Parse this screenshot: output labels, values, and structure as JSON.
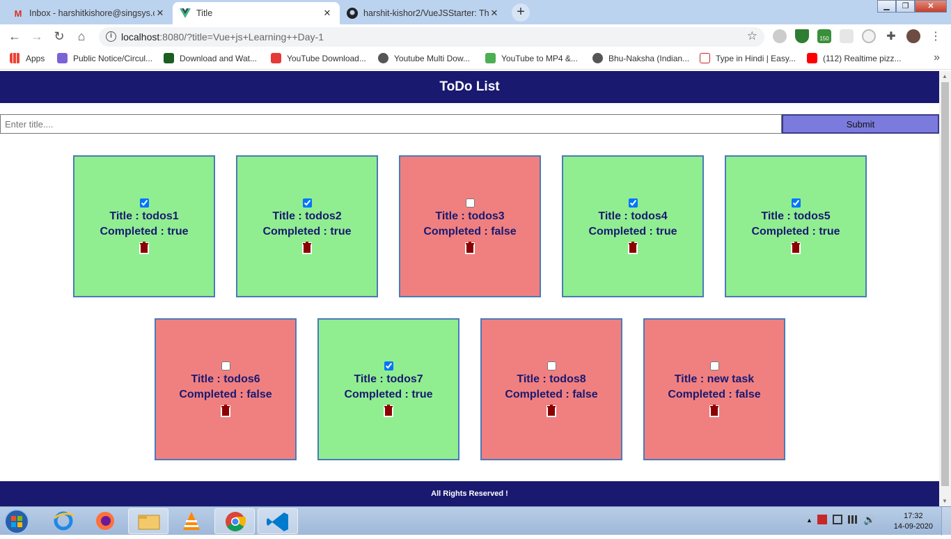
{
  "browser": {
    "tabs": [
      {
        "title": "Inbox - harshitkishore@singsys.c",
        "icon": "gmail-icon"
      },
      {
        "title": "Title",
        "icon": "vue-icon"
      },
      {
        "title": "harshit-kishor2/VueJSStarter: Thi",
        "icon": "github-icon"
      }
    ],
    "close_glyph": "✕",
    "new_tab_glyph": "+",
    "url_host": "localhost",
    "url_rest": ":8080/?title=Vue+js+Learning++Day-1",
    "extension_badge": "150",
    "bookmarks": [
      {
        "label": "Apps",
        "icon": "apps-grid-icon"
      },
      {
        "label": "Public Notice/Circul...",
        "icon": "notice-icon"
      },
      {
        "label": "Download and Wat...",
        "icon": "tr-icon"
      },
      {
        "label": "YouTube Download...",
        "icon": "download-icon"
      },
      {
        "label": "Youtube Multi Dow...",
        "icon": "globe-icon"
      },
      {
        "label": "YouTube to MP4 &...",
        "icon": "convert-icon"
      },
      {
        "label": "Bhu-Naksha (Indian...",
        "icon": "globe-icon"
      },
      {
        "label": "Type in Hindi | Easy...",
        "icon": "hindi-icon"
      },
      {
        "label": "(112) Realtime pizz...",
        "icon": "youtube-icon"
      }
    ]
  },
  "app": {
    "header_title": "ToDo List",
    "input_placeholder": "Enter title....",
    "submit_label": "Submit",
    "title_prefix": "Title : ",
    "completed_prefix": "Completed : ",
    "footer_text": "All Rights Reserved !"
  },
  "todos": [
    {
      "title": "todos1",
      "completed": true,
      "completed_text": "true"
    },
    {
      "title": "todos2",
      "completed": true,
      "completed_text": "true"
    },
    {
      "title": "todos3",
      "completed": false,
      "completed_text": "false"
    },
    {
      "title": "todos4",
      "completed": true,
      "completed_text": "true"
    },
    {
      "title": "todos5",
      "completed": true,
      "completed_text": "true"
    },
    {
      "title": "todos6",
      "completed": false,
      "completed_text": "false"
    },
    {
      "title": "todos7",
      "completed": true,
      "completed_text": "true"
    },
    {
      "title": "todos8",
      "completed": false,
      "completed_text": "false"
    },
    {
      "title": "new task",
      "completed": false,
      "completed_text": "false"
    }
  ],
  "colors": {
    "header_bg": "#191970",
    "done_card": "#90ee90",
    "todo_card": "#f08080",
    "submit_bg": "#7b7bde"
  },
  "taskbar": {
    "time": "17:32",
    "date": "14-09-2020",
    "pinned": [
      "ie-icon",
      "firefox-icon",
      "explorer-icon",
      "vlc-icon",
      "chrome-icon",
      "vscode-icon"
    ]
  }
}
